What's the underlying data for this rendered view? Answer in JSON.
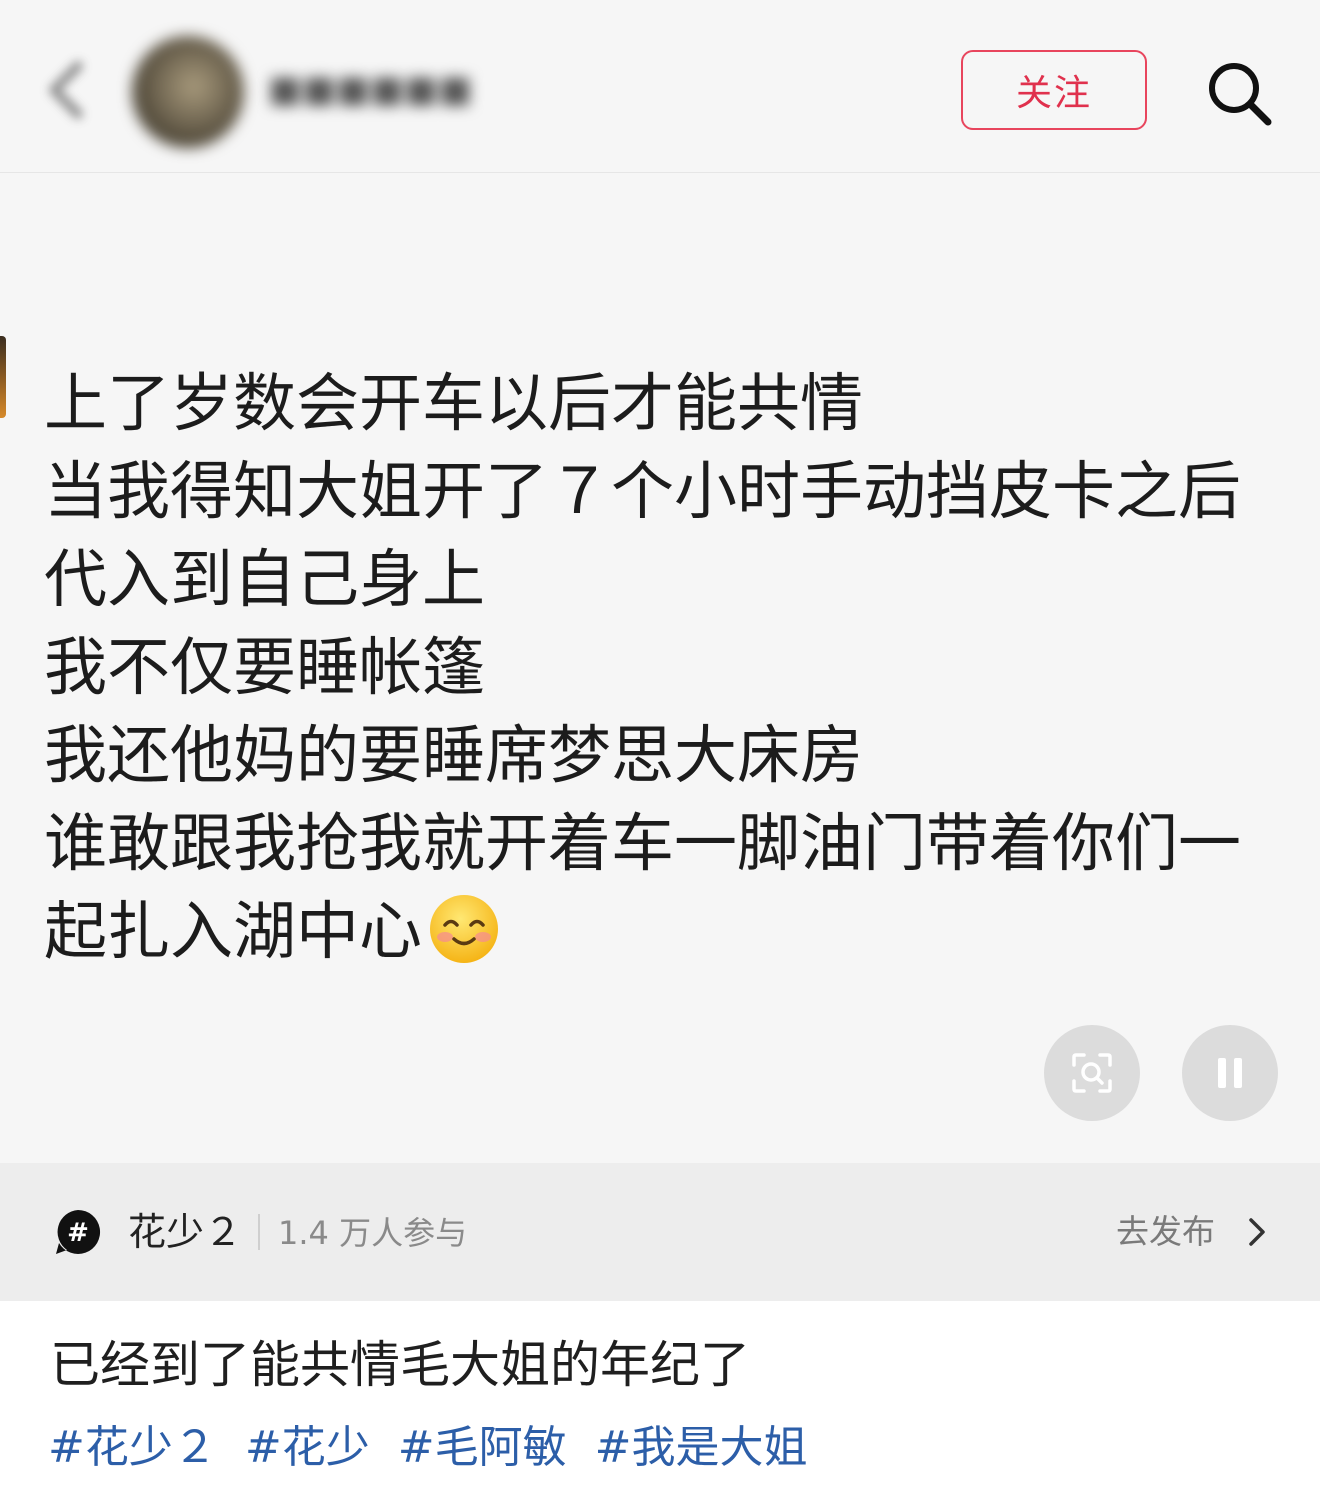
{
  "header": {
    "username": "■■■■■■",
    "follow_label": "关注",
    "icons": {
      "back": "chevron-left-icon",
      "search": "search-icon"
    }
  },
  "post": {
    "lines": [
      "上了岁数会开车以后才能共情",
      "当我得知大姐开了７个小时手动挡皮卡之后",
      "代入到自己身上",
      "我不仅要睡帐篷",
      "我还他妈的要睡席梦思大床房",
      "谁敢跟我抢我就开着车一脚油门带着你们一",
      "起扎入湖中心"
    ],
    "emoji": "smiling-face-with-blush-emoji"
  },
  "controls": {
    "scan_icon": "image-search-icon",
    "pause_icon": "pause-icon"
  },
  "topic": {
    "icon": "hashtag-icon",
    "name": "花少２",
    "participants": "1.4 万人参与",
    "action_label": "去发布"
  },
  "caption": {
    "title": "已经到了能共情毛大姐的年纪了",
    "tags": [
      "#花少２",
      "#花少",
      "#毛阿敏",
      "#我是大姐"
    ]
  },
  "colors": {
    "accent_red": "#e0314d",
    "tag_blue": "#2c5ea8",
    "background": "#f6f6f6"
  }
}
